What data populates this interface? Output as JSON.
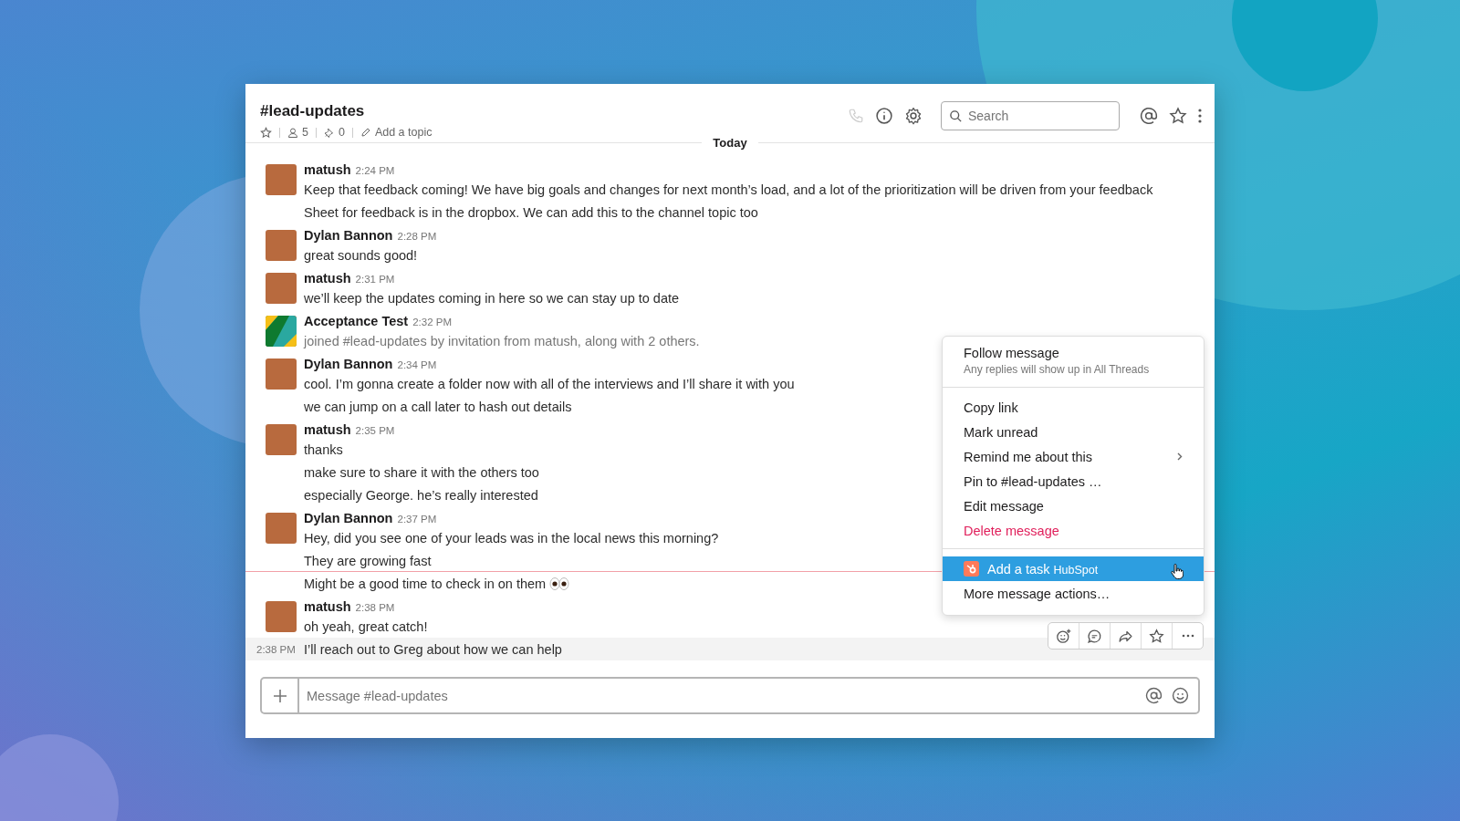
{
  "header": {
    "title": "#lead-updates",
    "members": "5",
    "pins": "0",
    "topic_placeholder": "Add a topic",
    "call_available": false,
    "search_placeholder": "Search"
  },
  "day_divider": "Today",
  "messages": [
    {
      "kind": "user",
      "author": "matush",
      "time": "2:24 PM",
      "lines": [
        {
          "text": "Keep that feedback coming! We have big goals and changes for next month’s load, and a lot of the prioritization will be driven from your feedback",
          "first_unread": false,
          "hovered": false
        },
        {
          "text": "Sheet for feedback is in the dropbox. We can add this to the channel topic too",
          "first_unread": false,
          "hovered": false
        }
      ]
    },
    {
      "kind": "user",
      "author": "Dylan Bannon",
      "time": "2:28 PM",
      "lines": [
        {
          "text": "great sounds good!",
          "first_unread": false,
          "hovered": false
        }
      ]
    },
    {
      "kind": "user",
      "author": "matush",
      "time": "2:31 PM",
      "lines": [
        {
          "text": "we’ll keep the updates coming in here so we can stay up to date",
          "first_unread": false,
          "hovered": false
        }
      ]
    },
    {
      "kind": "app",
      "author": "Acceptance Test",
      "time": "2:32 PM",
      "lines": [
        {
          "text": "joined #lead-updates by invitation from matush, along with 2 others.",
          "first_unread": false,
          "hovered": false
        }
      ]
    },
    {
      "kind": "user",
      "author": "Dylan Bannon",
      "time": "2:34 PM",
      "lines": [
        {
          "text": "cool. I’m gonna create a folder now with all of the interviews and I’ll share it with you",
          "first_unread": false,
          "hovered": false
        },
        {
          "text": "we can jump on a call later to hash out details",
          "first_unread": false,
          "hovered": false
        }
      ]
    },
    {
      "kind": "user",
      "author": "matush",
      "time": "2:35 PM",
      "lines": [
        {
          "text": "thanks",
          "first_unread": false,
          "hovered": false
        },
        {
          "text": "make sure to share it with the others too",
          "first_unread": false,
          "hovered": false
        },
        {
          "text": "especially George. he’s really interested",
          "first_unread": false,
          "hovered": false
        }
      ]
    },
    {
      "kind": "user",
      "author": "Dylan Bannon",
      "time": "2:37 PM",
      "lines": [
        {
          "text": "Hey, did you see one of your leads was in the local news this morning?",
          "first_unread": false,
          "hovered": false
        },
        {
          "text": "They are growing fast",
          "first_unread": false,
          "hovered": false
        },
        {
          "text": "Might be a good time to check in on them",
          "kind": "eyes",
          "first_unread": true,
          "hovered": false
        }
      ]
    },
    {
      "kind": "user",
      "author": "matush",
      "time": "2:38 PM",
      "lines": [
        {
          "text": "oh yeah, great catch!",
          "first_unread": false,
          "hovered": false
        },
        {
          "text": "I’ll reach out to Greg about how we can help",
          "time": "2:38 PM",
          "first_unread": false,
          "hovered": true
        }
      ]
    }
  ],
  "context_menu": {
    "sections": [
      [
        {
          "kind": "header",
          "label": "Follow message",
          "subtitle": "Any replies will show up in All Threads",
          "selected": false
        }
      ],
      [
        {
          "kind": "item",
          "label": "Copy link",
          "selected": false
        },
        {
          "kind": "item",
          "label": "Mark unread",
          "selected": false
        },
        {
          "kind": "submenu",
          "label": "Remind me about this",
          "selected": false
        },
        {
          "kind": "item",
          "label": "Pin to #lead-updates …",
          "selected": false
        },
        {
          "kind": "item",
          "label": "Edit message",
          "selected": false
        },
        {
          "kind": "danger",
          "label": "Delete message",
          "selected": false
        }
      ],
      [
        {
          "kind": "integration",
          "label": "Add a task",
          "app": "HubSpot",
          "selected": true
        },
        {
          "kind": "item",
          "label": "More message actions…",
          "selected": false
        }
      ]
    ]
  },
  "composer": {
    "placeholder": "Message #lead-updates"
  }
}
